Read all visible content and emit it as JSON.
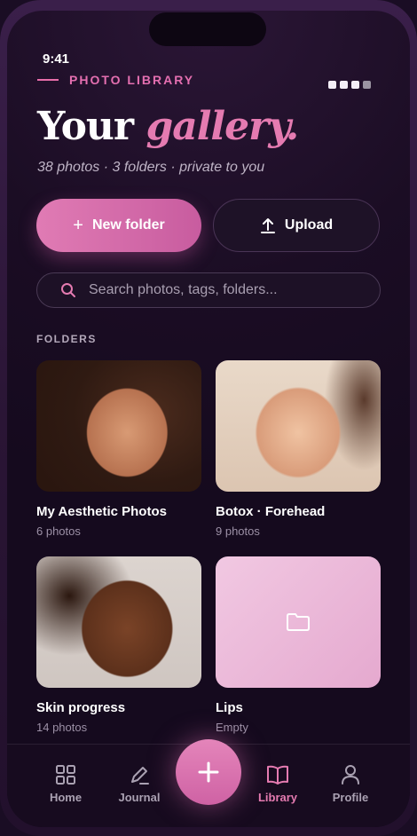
{
  "status": {
    "time": "9:41"
  },
  "header": {
    "eyebrow": "PHOTO LIBRARY",
    "title_main": "Your",
    "title_accent": "gallery.",
    "subtitle": "38 photos · 3 folders · private to you"
  },
  "actions": {
    "new_folder_label": "New folder",
    "upload_label": "Upload"
  },
  "search": {
    "placeholder": "Search photos, tags, folders..."
  },
  "folders": {
    "section_label": "FOLDERS",
    "items": [
      {
        "title": "My Aesthetic Photos",
        "count": "6 photos"
      },
      {
        "title": "Botox · Forehead",
        "count": "9 photos"
      },
      {
        "title": "Skin progress",
        "count": "14 photos"
      },
      {
        "title": "Lips",
        "count": "Empty"
      }
    ]
  },
  "nav": {
    "items": [
      {
        "label": "Home"
      },
      {
        "label": "Journal"
      },
      {
        "label": "Library"
      },
      {
        "label": "Profile"
      }
    ],
    "active": "Library"
  },
  "colors": {
    "accent": "#e57bb1",
    "background": "#1b0d24"
  }
}
